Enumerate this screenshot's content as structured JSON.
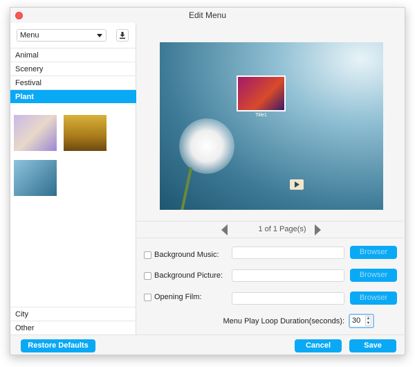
{
  "window": {
    "title": "Edit Menu"
  },
  "sidebar": {
    "dropdown": {
      "value": "Menu"
    },
    "categories": [
      {
        "label": "Animal"
      },
      {
        "label": "Scenery"
      },
      {
        "label": "Festival"
      },
      {
        "label": "Plant",
        "selected": true
      }
    ],
    "bottom_categories": [
      {
        "label": "City"
      },
      {
        "label": "Other"
      }
    ]
  },
  "preview": {
    "title_label": "Title1"
  },
  "pagination": {
    "text": "1 of 1 Page(s)"
  },
  "options": {
    "background_music": {
      "label": "Background Music:",
      "checked": false,
      "value": "",
      "button": "Browser"
    },
    "background_picture": {
      "label": "Background Picture:",
      "checked": false,
      "value": "",
      "button": "Browser"
    },
    "opening_film": {
      "label": "Opening Film:",
      "checked": false,
      "value": "",
      "button": "Browser"
    },
    "loop_duration": {
      "label": "Menu Play Loop Duration(seconds):",
      "value": "30"
    }
  },
  "footer": {
    "restore": "Restore Defaults",
    "cancel": "Cancel",
    "save": "Save"
  },
  "colors": {
    "accent": "#0aa9f5"
  }
}
